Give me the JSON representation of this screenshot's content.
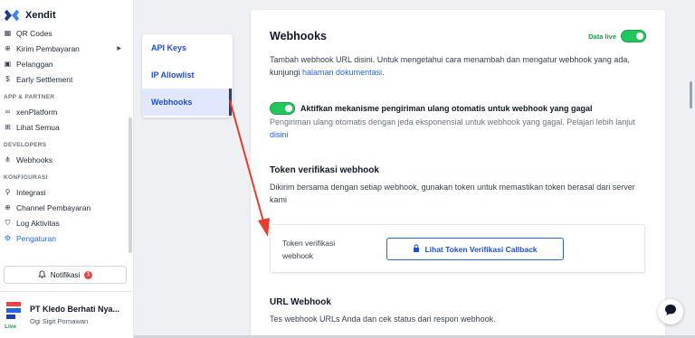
{
  "sidebar": {
    "brand": "Xendit",
    "items": [
      {
        "label": "QR Codes",
        "icon": "grid-icon"
      },
      {
        "label": "Kirim Pembayaran",
        "icon": "send-icon",
        "has_caret": true
      },
      {
        "label": "Pelanggan",
        "icon": "id-card-icon"
      },
      {
        "label": "Early Settlement",
        "icon": "dollar-circle-icon"
      }
    ],
    "section_partner": "APP & PARTNER",
    "partner_items": [
      {
        "label": "xenPlatform",
        "icon": "handshake-icon"
      },
      {
        "label": "Lihat Semua",
        "icon": "apps-icon"
      }
    ],
    "section_developers": "DEVELOPERS",
    "developer_items": [
      {
        "label": "Webhooks",
        "icon": "webhook-icon"
      }
    ],
    "section_config": "KONFIGURASI",
    "config_items": [
      {
        "label": "Integrasi",
        "icon": "plug-icon"
      },
      {
        "label": "Channel Pembayaran",
        "icon": "plus-circle-icon"
      },
      {
        "label": "Log Aktivitas",
        "icon": "shield-icon"
      },
      {
        "label": "Pengaturan",
        "icon": "gear-icon",
        "active": true
      }
    ],
    "notification_label": "Notifikasi",
    "notification_count": "1",
    "account_name": "PT Kledo Berhati Nya...",
    "account_user": "Ogi Sigit Pornawan",
    "live_badge": "Live"
  },
  "submenu": {
    "items": [
      "API Keys",
      "IP Allowlist",
      "Webhooks"
    ],
    "active": "Webhooks"
  },
  "main": {
    "title": "Webhooks",
    "live_label": "Data live",
    "desc_text": "Tambah webhook URL disini. Untuk mengetahui cara menambah dan mengatur webhook yang ada, kunjungi ",
    "desc_link": "halaman dokumentasi",
    "desc_end": ".",
    "retry_label": "Aktifkan mekanisme pengiriman ulang otomatis untuk webhook yang gagal",
    "retry_desc": "Pengiriman ulang otomatis dengan jeda eksponensial untuk webhook yang gagal. Pelajari lebih lanjut ",
    "retry_link": "disini",
    "token_title": "Token verifikasi webhook",
    "token_desc": "Dikirim bersama dengan setiap webhook, gunakan token untuk memastikan token berasal dari server kami",
    "token_box_label": "Token verifikasi webhook",
    "token_button": "Lihat Token Verifikasi Callback",
    "url_title": "URL Webhook",
    "url_desc": "Tes webhook URLs Anda dan cek status dari respon webhook."
  },
  "colors": {
    "accent": "#2563eb",
    "live_green": "#22c55e",
    "annotation_arrow": "#e53e2e"
  }
}
